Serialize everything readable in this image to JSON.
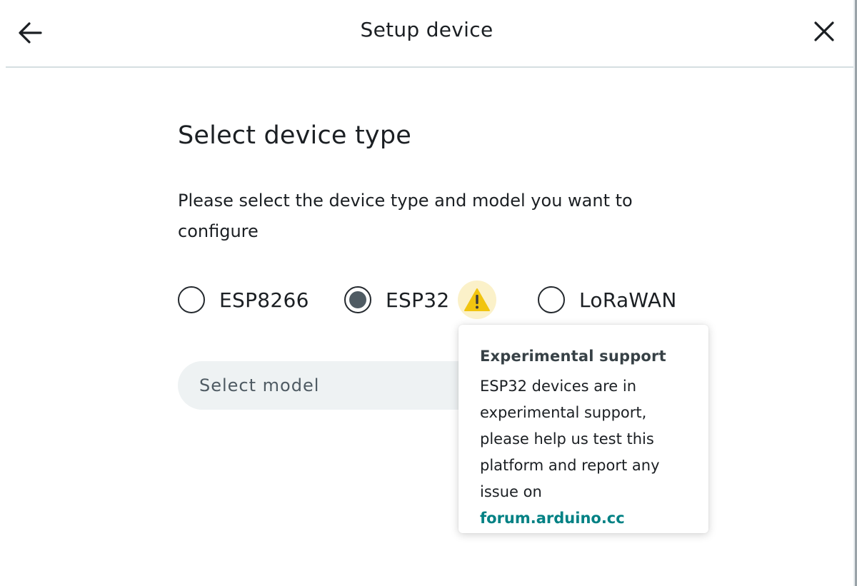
{
  "header": {
    "title": "Setup device",
    "back_icon": "arrow-left-icon",
    "close_icon": "close-icon"
  },
  "main": {
    "section_title": "Select device type",
    "description": "Please select the device type and model you want to configure",
    "device_types": [
      {
        "label": "ESP8266",
        "selected": false
      },
      {
        "label": "ESP32",
        "selected": true,
        "badge_icon": "warning-icon"
      },
      {
        "label": "LoRaWAN",
        "selected": false
      }
    ],
    "model_select": {
      "placeholder": "Select model"
    }
  },
  "tooltip": {
    "title": "Experimental support",
    "body": "ESP32 devices are in experimental support, please help us test this platform and report any issue on",
    "link_text": "forum.arduino.cc"
  },
  "colors": {
    "accent_teal": "#008184",
    "radio_fill": "#4f5b63",
    "warning_yellow": "#f1c40f",
    "warning_bg": "#fbf1c9",
    "select_bg": "#eef2f3",
    "divider": "#d5dee1"
  }
}
